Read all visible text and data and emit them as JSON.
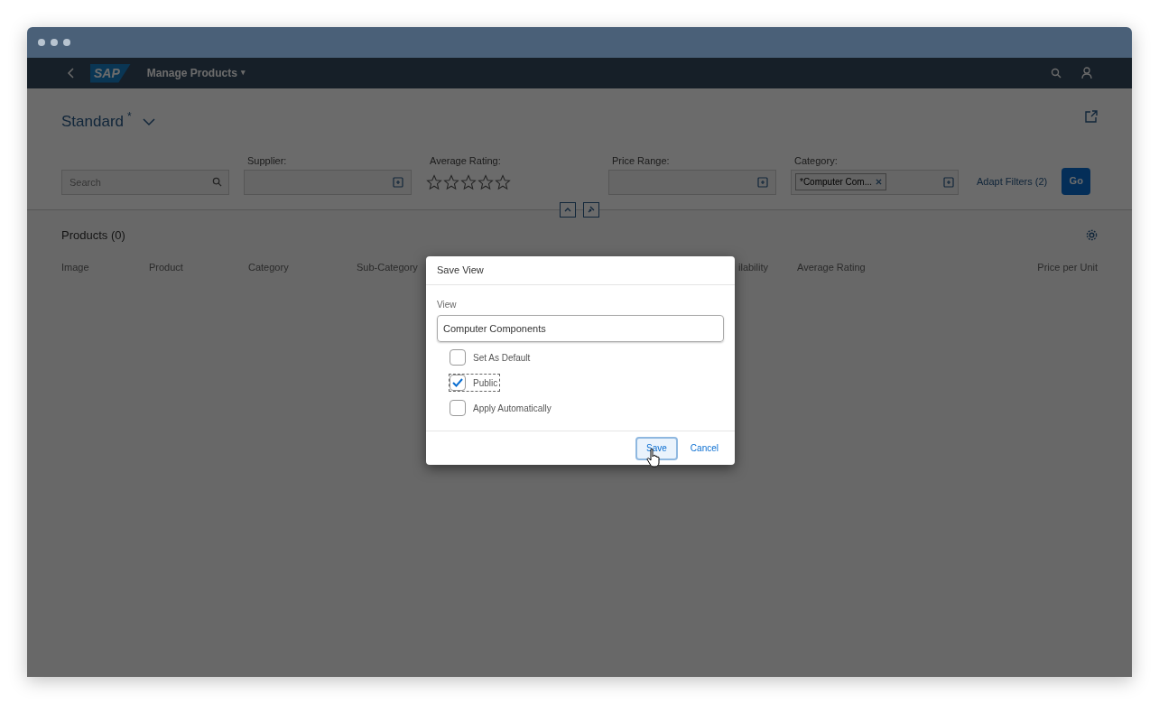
{
  "shell": {
    "logo": "SAP",
    "title": "Manage Products",
    "caret": "▾"
  },
  "variant": {
    "name": "Standard",
    "modified_mark": "*"
  },
  "filters": [
    {
      "kind": "search",
      "placeholder": "Search"
    },
    {
      "kind": "value_help",
      "label": "Supplier:"
    },
    {
      "kind": "rating",
      "label": "Average Rating:",
      "stars": 0
    },
    {
      "kind": "value_help",
      "label": "Price Range:"
    },
    {
      "kind": "token",
      "label": "Category:",
      "token": "*Computer Com..."
    }
  ],
  "adapt_filters": "Adapt Filters (2)",
  "go": "Go",
  "table": {
    "title": "Products (0)",
    "columns": [
      "Image",
      "Product",
      "Category",
      "Sub-Category",
      "ilability",
      "Average Rating",
      "Price per Unit"
    ]
  },
  "dialog": {
    "title": "Save View",
    "field_label": "View",
    "field_value": "Computer Components",
    "options": [
      {
        "label": "Set As Default",
        "checked": false,
        "focused": false
      },
      {
        "label": "Public",
        "checked": true,
        "focused": true
      },
      {
        "label": "Apply Automatically",
        "checked": false,
        "focused": false
      }
    ],
    "buttons": [
      {
        "label": "Save",
        "kind": "primary"
      },
      {
        "label": "Cancel",
        "kind": "secondary"
      }
    ]
  }
}
